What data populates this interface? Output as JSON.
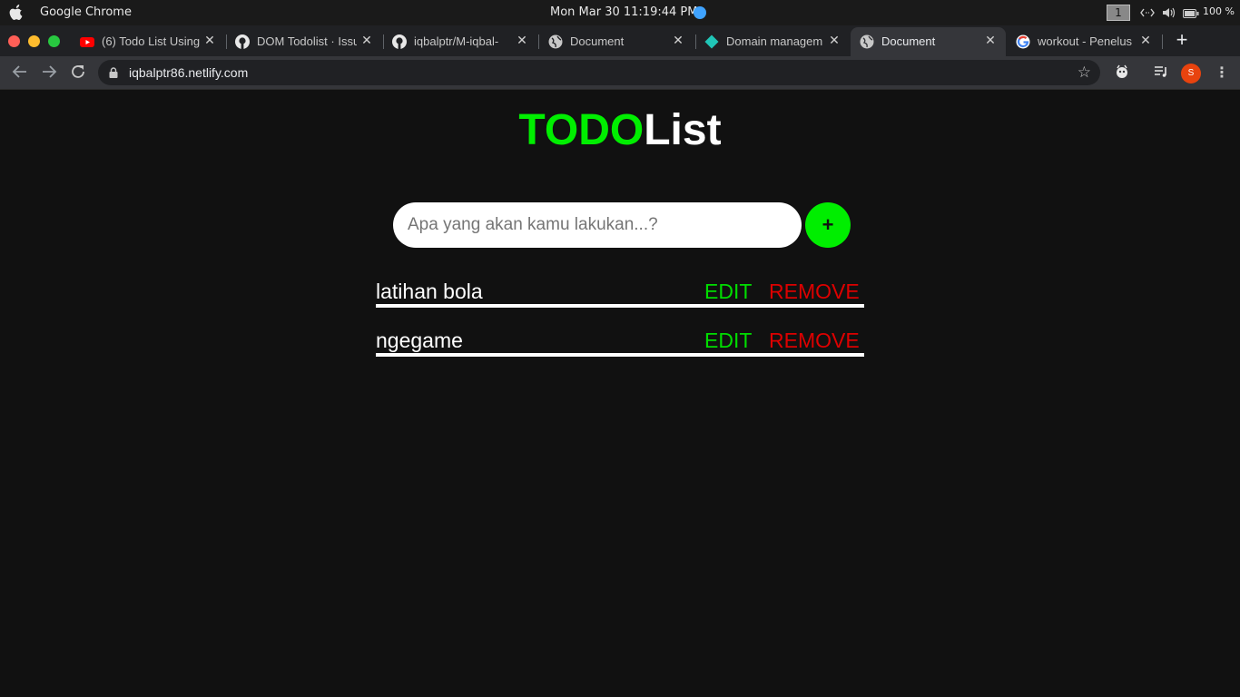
{
  "os": {
    "app_name": "Google Chrome",
    "clock": "Mon Mar 30   11:19:44 PM",
    "workspace": "1",
    "battery": "100 %"
  },
  "tabs": [
    {
      "title": "(6) Todo List Using",
      "icon": "youtube-icon"
    },
    {
      "title": "DOM Todolist · Issu",
      "icon": "github-icon"
    },
    {
      "title": "iqbalptr/M-iqbal-",
      "icon": "github-icon"
    },
    {
      "title": "Document",
      "icon": "globe-icon"
    },
    {
      "title": "Domain managem",
      "icon": "netlify-icon"
    },
    {
      "title": "Document",
      "icon": "globe-icon",
      "active": true
    },
    {
      "title": "workout - Penelus",
      "icon": "google-icon"
    }
  ],
  "toolbar": {
    "url": "iqbalptr86.netlify.com",
    "profile_initial": "S"
  },
  "app": {
    "title_strong": "TODO",
    "title_rest": "List",
    "input_placeholder": "Apa yang akan kamu lakukan...?",
    "add_label": "+",
    "items": [
      {
        "text": "latihan bola",
        "edit_label": "EDIT",
        "remove_label": "REMOVE"
      },
      {
        "text": "ngegame",
        "edit_label": "EDIT",
        "remove_label": "REMOVE"
      }
    ]
  },
  "colors": {
    "accent": "#00ee00",
    "danger": "#dd0000",
    "background": "#111111"
  }
}
